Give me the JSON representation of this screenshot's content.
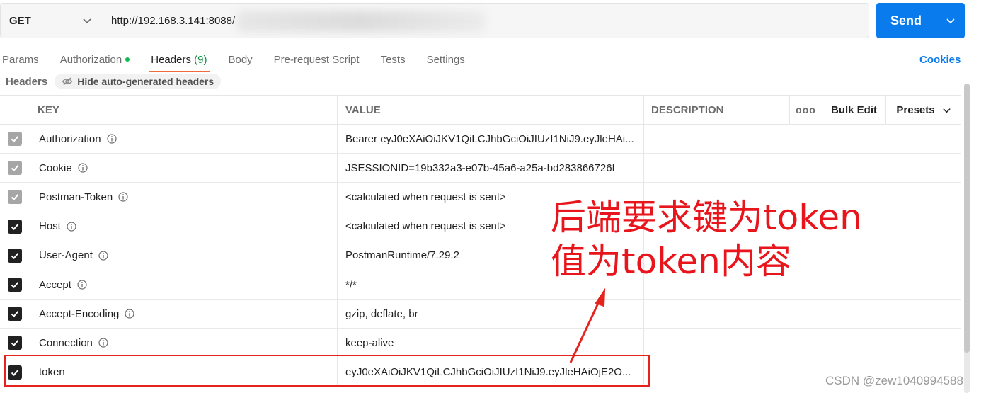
{
  "request": {
    "method": "GET",
    "url": "http://192.168.3.141:8088/",
    "send_label": "Send"
  },
  "tabs": [
    {
      "label": "Params"
    },
    {
      "label": "Authorization"
    },
    {
      "label": "Headers",
      "count": "(9)"
    },
    {
      "label": "Body"
    },
    {
      "label": "Pre-request Script"
    },
    {
      "label": "Tests"
    },
    {
      "label": "Settings"
    }
  ],
  "cookies_label": "Cookies",
  "headers_section": {
    "title": "Headers",
    "hide_auto_label": "Hide auto-generated headers"
  },
  "table": {
    "columns": {
      "key": "KEY",
      "value": "VALUE",
      "description": "DESCRIPTION"
    },
    "more_label": "ooo",
    "bulk_edit_label": "Bulk Edit",
    "presets_label": "Presets",
    "rows": [
      {
        "key": "Authorization",
        "value": "Bearer eyJ0eXAiOiJKV1QiLCJhbGciOiJIUzI1NiJ9.eyJleHAi...",
        "checked": "auto"
      },
      {
        "key": "Cookie",
        "value": "JSESSIONID=19b332a3-e07b-45a6-a25a-bd283866726f",
        "checked": "auto"
      },
      {
        "key": "Postman-Token",
        "value": "<calculated when request is sent>",
        "checked": "auto"
      },
      {
        "key": "Host",
        "value": "<calculated when request is sent>",
        "checked": "on"
      },
      {
        "key": "User-Agent",
        "value": "PostmanRuntime/7.29.2",
        "checked": "on"
      },
      {
        "key": "Accept",
        "value": "*/*",
        "checked": "on"
      },
      {
        "key": "Accept-Encoding",
        "value": "gzip, deflate, br",
        "checked": "on"
      },
      {
        "key": "Connection",
        "value": "keep-alive",
        "checked": "on"
      },
      {
        "key": "token",
        "value": "eyJ0eXAiOiJKV1QiLCJhbGciOiJIUzI1NiJ9.eyJleHAiOjE2O...",
        "checked": "on"
      }
    ]
  },
  "annotation": {
    "line1": "后端要求键为token",
    "line2": "值为token内容",
    "color": "#e8151c"
  },
  "watermark": "CSDN @zew1040994588",
  "colors": {
    "accent": "#097bed",
    "active_tab": "#f26b3a",
    "auth_dot": "#0cbb52"
  }
}
